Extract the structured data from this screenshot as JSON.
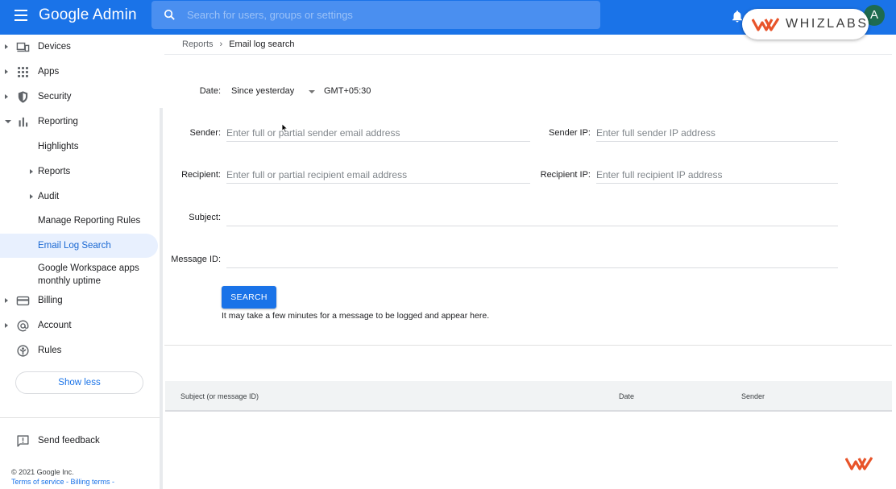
{
  "header": {
    "app_title": "Google Admin",
    "search_placeholder": "Search for users, groups or settings",
    "avatar_letter": "A",
    "overlay_logo_text": "WHIZLABS"
  },
  "sidebar": {
    "items": [
      {
        "label": "Devices",
        "icon": "devices-icon"
      },
      {
        "label": "Apps",
        "icon": "apps-grid-icon"
      },
      {
        "label": "Security",
        "icon": "shield-icon"
      },
      {
        "label": "Reporting",
        "icon": "bar-chart-icon"
      },
      {
        "label": "Highlights"
      },
      {
        "label": "Reports"
      },
      {
        "label": "Audit"
      },
      {
        "label": "Manage Reporting Rules"
      },
      {
        "label": "Email Log Search"
      },
      {
        "label": "Google Workspace apps monthly uptime"
      },
      {
        "label": "Billing",
        "icon": "credit-card-icon"
      },
      {
        "label": "Account",
        "icon": "at-sign-icon"
      },
      {
        "label": "Rules",
        "icon": "rules-icon"
      }
    ],
    "show_less_label": "Show less",
    "feedback_label": "Send feedback",
    "copyright": "© 2021 Google Inc.",
    "terms_link": "Terms of service",
    "billing_terms_link": "Billing terms",
    "link_separator": " - "
  },
  "breadcrumb": {
    "parent": "Reports",
    "separator": "›",
    "current": "Email log search"
  },
  "form": {
    "date_label": "Date:",
    "date_value": "Since yesterday",
    "timezone": "GMT+05:30",
    "sender_label": "Sender:",
    "sender_placeholder": "Enter full or partial sender email address",
    "sender_ip_label": "Sender IP:",
    "sender_ip_placeholder": "Enter full sender IP address",
    "recipient_label": "Recipient:",
    "recipient_placeholder": "Enter full or partial recipient email address",
    "recipient_ip_label": "Recipient IP:",
    "recipient_ip_placeholder": "Enter full recipient IP address",
    "subject_label": "Subject:",
    "subject_value": "",
    "message_id_label": "Message ID:",
    "message_id_value": "",
    "search_button": "SEARCH",
    "note": "It may take a few minutes for a message to be logged and appear here."
  },
  "results": {
    "columns": [
      "Subject (or message ID)",
      "Date",
      "Sender"
    ]
  },
  "colors": {
    "brand_blue": "#1a73e8",
    "active_bg": "#e8f0fe",
    "avatar_bg": "#1e6b4f",
    "logo_orange": "#e8542a"
  }
}
